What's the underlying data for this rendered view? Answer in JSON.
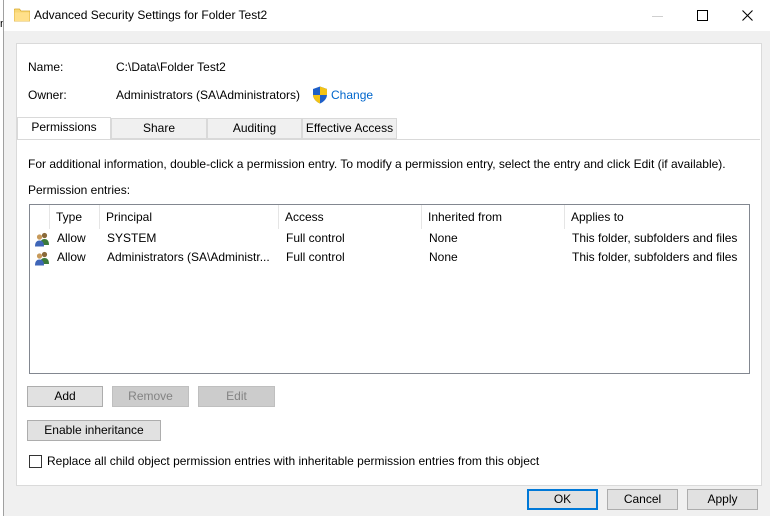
{
  "window": {
    "title": "Advanced Security Settings for Folder Test2"
  },
  "info": {
    "name_label": "Name:",
    "name_value": "C:\\Data\\Folder Test2",
    "owner_label": "Owner:",
    "owner_value": "Administrators (SA\\Administrators)",
    "change_link": "Change"
  },
  "tabs": [
    {
      "label": "Permissions",
      "active": true
    },
    {
      "label": "Share",
      "active": false
    },
    {
      "label": "Auditing",
      "active": false
    },
    {
      "label": "Effective Access",
      "active": false
    }
  ],
  "permissions": {
    "instructions": "For additional information, double-click a permission entry. To modify a permission entry, select the entry and click Edit (if available).",
    "entries_label": "Permission entries:",
    "columns": [
      "Type",
      "Principal",
      "Access",
      "Inherited from",
      "Applies to"
    ],
    "rows": [
      {
        "type": "Allow",
        "principal": "SYSTEM",
        "access": "Full control",
        "inherited": "None",
        "applies": "This folder, subfolders and files"
      },
      {
        "type": "Allow",
        "principal": "Administrators (SA\\Administr...",
        "access": "Full control",
        "inherited": "None",
        "applies": "This folder, subfolders and files"
      }
    ],
    "add": "Add",
    "remove": "Remove",
    "edit": "Edit",
    "enable_inheritance": "Enable inheritance",
    "replace_label": "Replace all child object permission entries with inheritable permission entries from this object",
    "replace_checked": false
  },
  "footer": {
    "ok": "OK",
    "cancel": "Cancel",
    "apply": "Apply"
  },
  "colors": {
    "link": "#0066cc",
    "accent": "#0078d7"
  }
}
